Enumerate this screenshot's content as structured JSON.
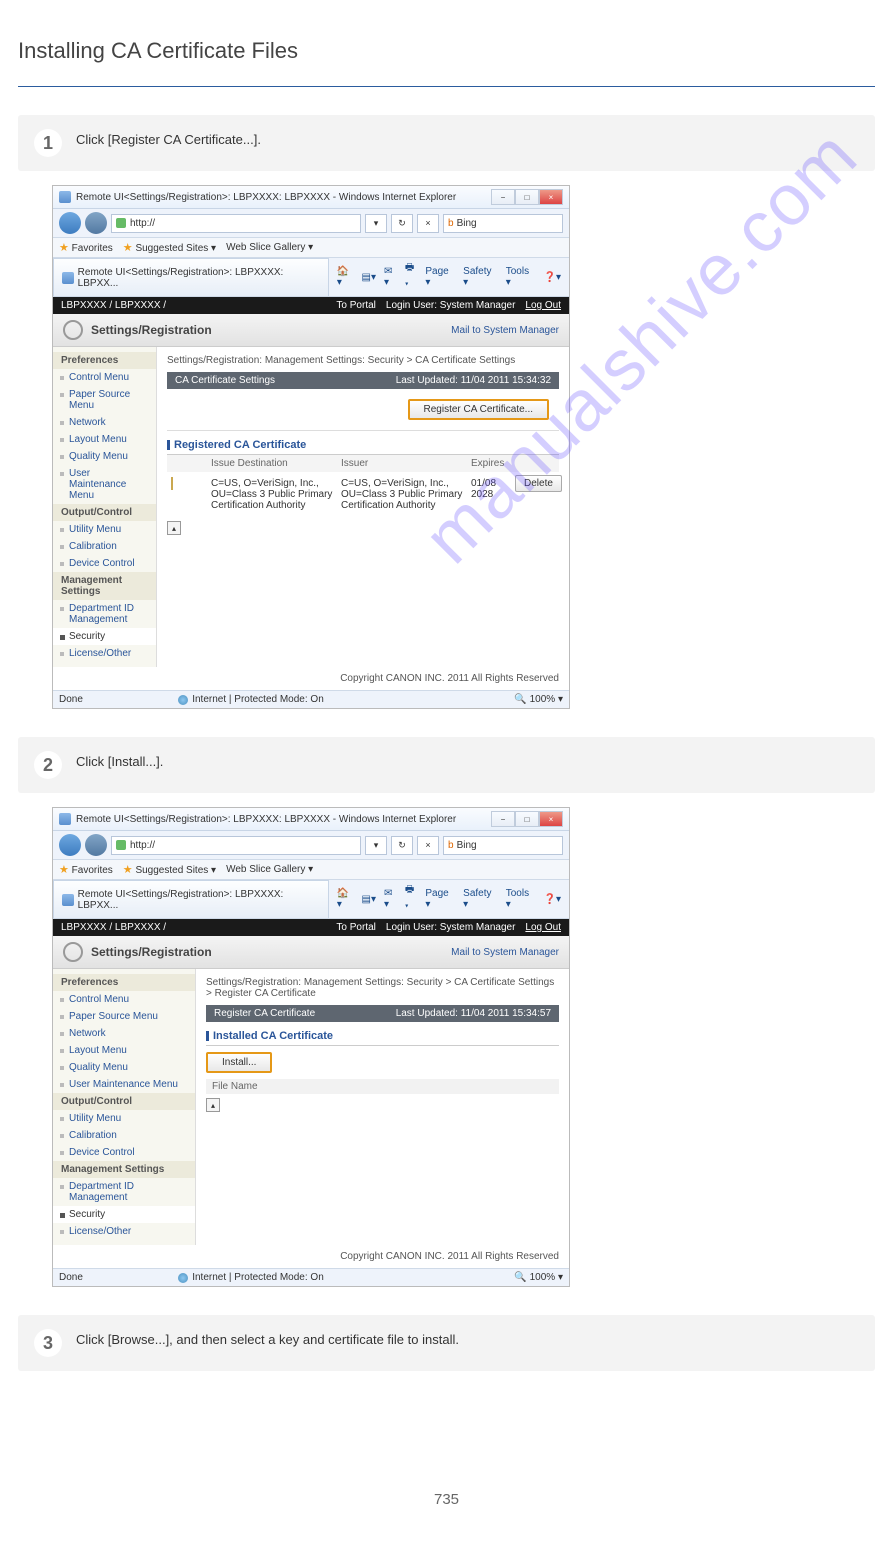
{
  "page": {
    "title": "Installing CA Certificate Files",
    "number": "735"
  },
  "steps": {
    "s1": {
      "num": "1",
      "text": "Click [Register CA Certificate...]."
    },
    "s2": {
      "num": "2",
      "text": "Click [Install...]."
    },
    "s3": {
      "num": "3",
      "text": "Click [Browse...], and then select a key and certificate file to install."
    }
  },
  "ie": {
    "title": "Remote UI<Settings/Registration>: LBPXXXX: LBPXXXX - Windows Internet Explorer",
    "url": "http://",
    "bing": "Bing",
    "fav": "Favorites",
    "sugg": "Suggested Sites ▾",
    "webslice": "Web Slice Gallery ▾",
    "tab": "Remote UI<Settings/Registration>: LBPXXXX: LBPXX...",
    "tb_page": "Page ▾",
    "tb_safety": "Safety ▾",
    "tb_tools": "Tools ▾",
    "done": "Done",
    "protected": "Internet | Protected Mode: On",
    "zoom": "100%"
  },
  "remoteui": {
    "device": "LBPXXXX / LBPXXXX /",
    "portal": "To Portal",
    "loginuser": "Login User: System Manager",
    "logout": "Log Out",
    "sr": "Settings/Registration",
    "mailto": "Mail to System Manager",
    "pref": "Preferences",
    "m_control": "Control Menu",
    "m_paper": "Paper Source Menu",
    "m_network": "Network",
    "m_layout": "Layout Menu",
    "m_quality": "Quality Menu",
    "m_usermaint": "User Maintenance Menu",
    "out": "Output/Control",
    "m_utility": "Utility Menu",
    "m_calib": "Calibration",
    "m_devctrl": "Device Control",
    "mgmt": "Management Settings",
    "m_dept": "Department ID Management",
    "m_security": "Security",
    "m_license": "License/Other",
    "copyright": "Copyright CANON INC. 2011 All Rights Reserved"
  },
  "s1": {
    "bc": "Settings/Registration: Management Settings: Security > CA Certificate Settings",
    "hdr": "CA Certificate Settings",
    "ts": "Last Updated: 11/04 2011 15:34:32",
    "regbtn": "Register CA Certificate...",
    "sect": "Registered CA Certificate",
    "th_issue": "Issue Destination",
    "th_issuer": "Issuer",
    "th_exp": "Expires",
    "issue": "C=US, O=VeriSign, Inc., OU=Class 3 Public Primary Certification Authority",
    "issuer": "C=US, O=VeriSign, Inc., OU=Class 3 Public Primary Certification Authority",
    "exp": "01/08 2028",
    "del": "Delete"
  },
  "s2": {
    "bc": "Settings/Registration: Management Settings: Security > CA Certificate Settings > Register CA Certificate",
    "hdr": "Register CA Certificate",
    "ts": "Last Updated: 11/04 2011 15:34:57",
    "sect": "Installed CA Certificate",
    "install": "Install...",
    "fn": "File Name"
  },
  "watermark": "manualshive.com"
}
